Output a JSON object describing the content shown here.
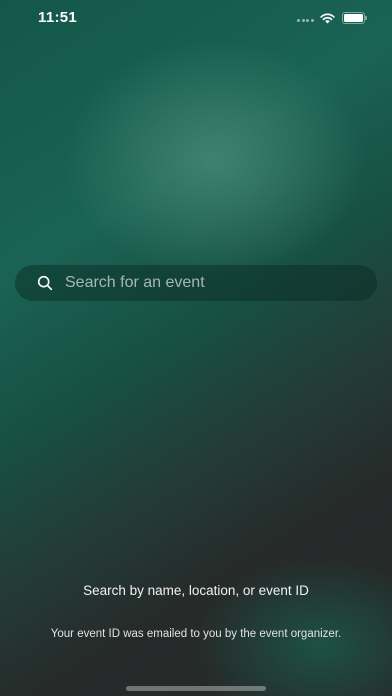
{
  "status_bar": {
    "time": "11:51",
    "signal_icon": "cellular-signal-icon",
    "wifi_icon": "wifi-icon",
    "battery_icon": "battery-full-icon"
  },
  "search": {
    "placeholder": "Search for an event",
    "value": "",
    "icon": "search-icon"
  },
  "hints": {
    "primary": "Search by name, location, or event ID",
    "secondary": "Your event ID was emailed to you by the event organizer."
  },
  "theme": {
    "background_primary": "#1a6354",
    "background_dark": "#272727",
    "text_color": "#ffffff"
  }
}
